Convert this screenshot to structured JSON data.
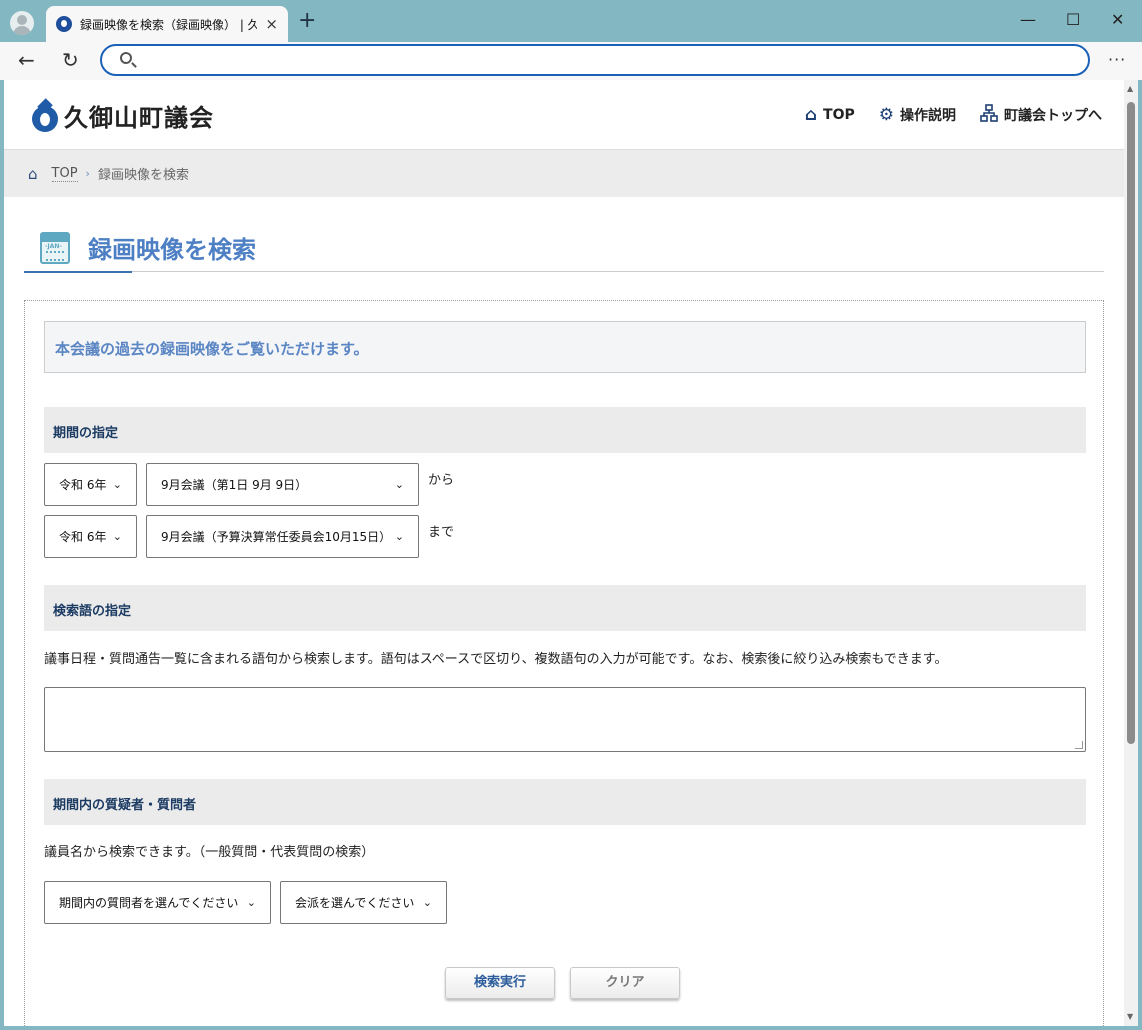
{
  "browser": {
    "tab_title": "録画映像を検索（録画映像） | 久御山町議会",
    "tab_close": "×",
    "new_tab": "+",
    "window_controls": {
      "minimize": "—",
      "maximize": "☐",
      "close": "✕"
    },
    "nav": {
      "back": "←",
      "reload": "↻"
    },
    "address_value": "",
    "more": "···"
  },
  "site": {
    "logo_text": "久御山町議会",
    "nav": [
      {
        "icon": "home-icon",
        "label": "TOP"
      },
      {
        "icon": "gear-icon",
        "label": "操作説明"
      },
      {
        "icon": "sitemap-icon",
        "label": "町議会トップへ"
      }
    ]
  },
  "breadcrumb": {
    "home": "TOP",
    "separator": "›",
    "current": "録画映像を検索"
  },
  "page": {
    "calendar_label": "-JAN-",
    "title": "録画映像を検索"
  },
  "intro": "本会議の過去の録画映像をご覧いただけます。",
  "period": {
    "heading": "期間の指定",
    "from_year": "令和 6年",
    "from_session": "9月会議（第1日 9月 9日）",
    "from_suffix": "から",
    "to_year": "令和 6年",
    "to_session": "9月会議（予算決算常任委員会10月15日）",
    "to_suffix": "まで"
  },
  "keyword": {
    "heading": "検索語の指定",
    "description": "議事日程・質問通告一覧に含まれる語句から検索します。語句はスペースで区切り、複数語句の入力が可能です。なお、検索後に絞り込み検索もできます。",
    "value": ""
  },
  "questioner": {
    "heading": "期間内の質疑者・質問者",
    "description": "議員名から検索できます。（一般質問・代表質問の検索）",
    "member_select": "期間内の質問者を選んでください",
    "faction_select": "会派を選んでください"
  },
  "buttons": {
    "search": "検索実行",
    "clear": "クリア"
  },
  "colors": {
    "accent": "#4d7fc4",
    "heading_text": "#1c3b63",
    "browser_frame": "#83b7c1"
  }
}
